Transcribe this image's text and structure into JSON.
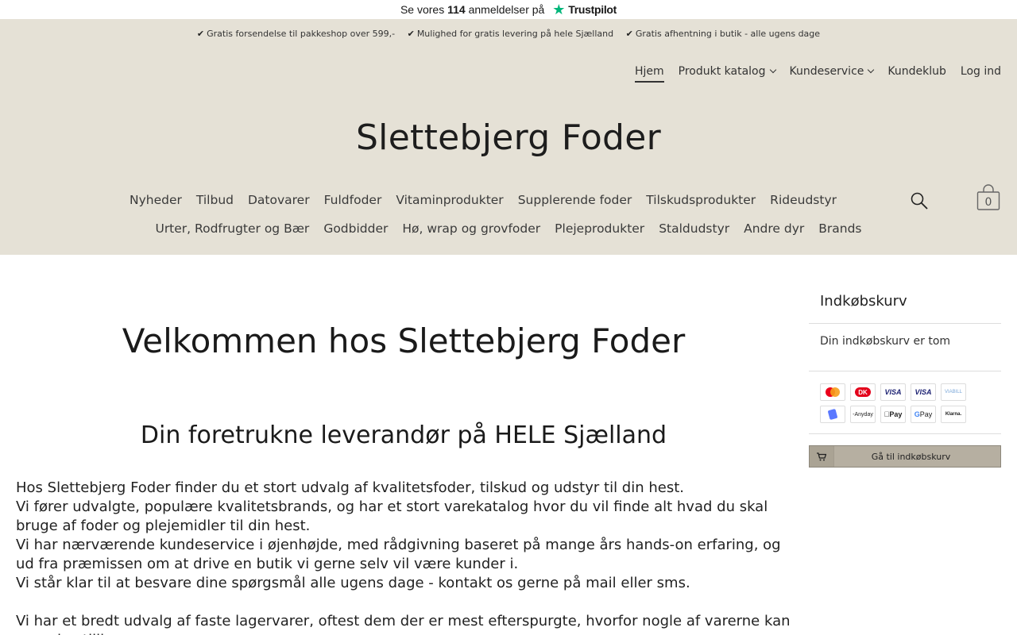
{
  "trustpilot": {
    "prefix": "Se vores",
    "count": "114",
    "mid": "anmeldelser på",
    "brand": "Trustpilot"
  },
  "usps": [
    "Gratis forsendelse til pakkeshop over 599,-",
    "Mulighed for gratis levering på hele Sjælland",
    "Gratis afhentning i butik - alle ugens dage"
  ],
  "topnav": [
    {
      "label": "Hjem",
      "active": true
    },
    {
      "label": "Produkt katalog",
      "dropdown": true
    },
    {
      "label": "Kundeservice",
      "dropdown": true
    },
    {
      "label": "Kundeklub"
    },
    {
      "label": "Log ind"
    }
  ],
  "logo": "Slettebjerg Foder",
  "categories_row1": [
    "Nyheder",
    "Tilbud",
    "Datovarer",
    "Fuldfoder",
    "Vitaminprodukter",
    "Supplerende foder",
    "Tilskudsprodukter",
    "Rideudstyr"
  ],
  "categories_row2": [
    "Urter, Rodfrugter og Bær",
    "Godbidder",
    "Hø, wrap og grovfoder",
    "Plejeprodukter",
    "Staldudstyr",
    "Andre dyr",
    "Brands"
  ],
  "cart": {
    "count": "0"
  },
  "main": {
    "heading": "Velkommen hos Slettebjerg Foder",
    "subheading": "Din foretrukne leverandør på HELE Sjælland",
    "paragraphs": [
      "Hos Slettebjerg Foder finder du et stort udvalg af kvalitetsfoder, tilskud og udstyr til din hest.",
      "Vi fører udvalgte, populære kvalitetsbrands, og har et stort varekatalog hvor du vil finde alt hvad du skal bruge af foder og plejemidler til din hest.",
      "Vi har nærværende kundeservice i øjenhøjde, med rådgivning baseret på mange års hands-on erfaring, og ud fra præmissen om at drive en butik vi gerne selv vil være kunder i.",
      "Vi står klar til at besvare dine spørgsmål alle ugens dage - kontakt os gerne på mail eller sms.",
      "Vi har et bredt udvalg af faste lagervarer, oftest dem der er mest efterspurgte, hvorfor nogle af varerne kan være bestillingsvarer."
    ]
  },
  "sidebar": {
    "title": "Indkøbskurv",
    "empty_text": "Din indkøbskurv er tom",
    "button_label": "Gå til indkøbskurv",
    "payment_icons": [
      "mastercard-icon",
      "dankort-icon",
      "visa-electron-icon",
      "visa-icon",
      "mobilepay-icon",
      "viabill-icon",
      "anyday-icon",
      "apple-pay-icon",
      "google-pay-icon",
      "klarna-icon"
    ],
    "payment_labels": {
      "visa": "VISA",
      "viabill": "VIABILL",
      "anyday": "-Anyday",
      "applepay": "Pay",
      "googlepay": "Pay",
      "klarna": "Klarna."
    }
  },
  "colors": {
    "header_bg": "#e5e1d6",
    "button_bg": "#b6afa1",
    "trustpilot_green": "#00b67a"
  }
}
